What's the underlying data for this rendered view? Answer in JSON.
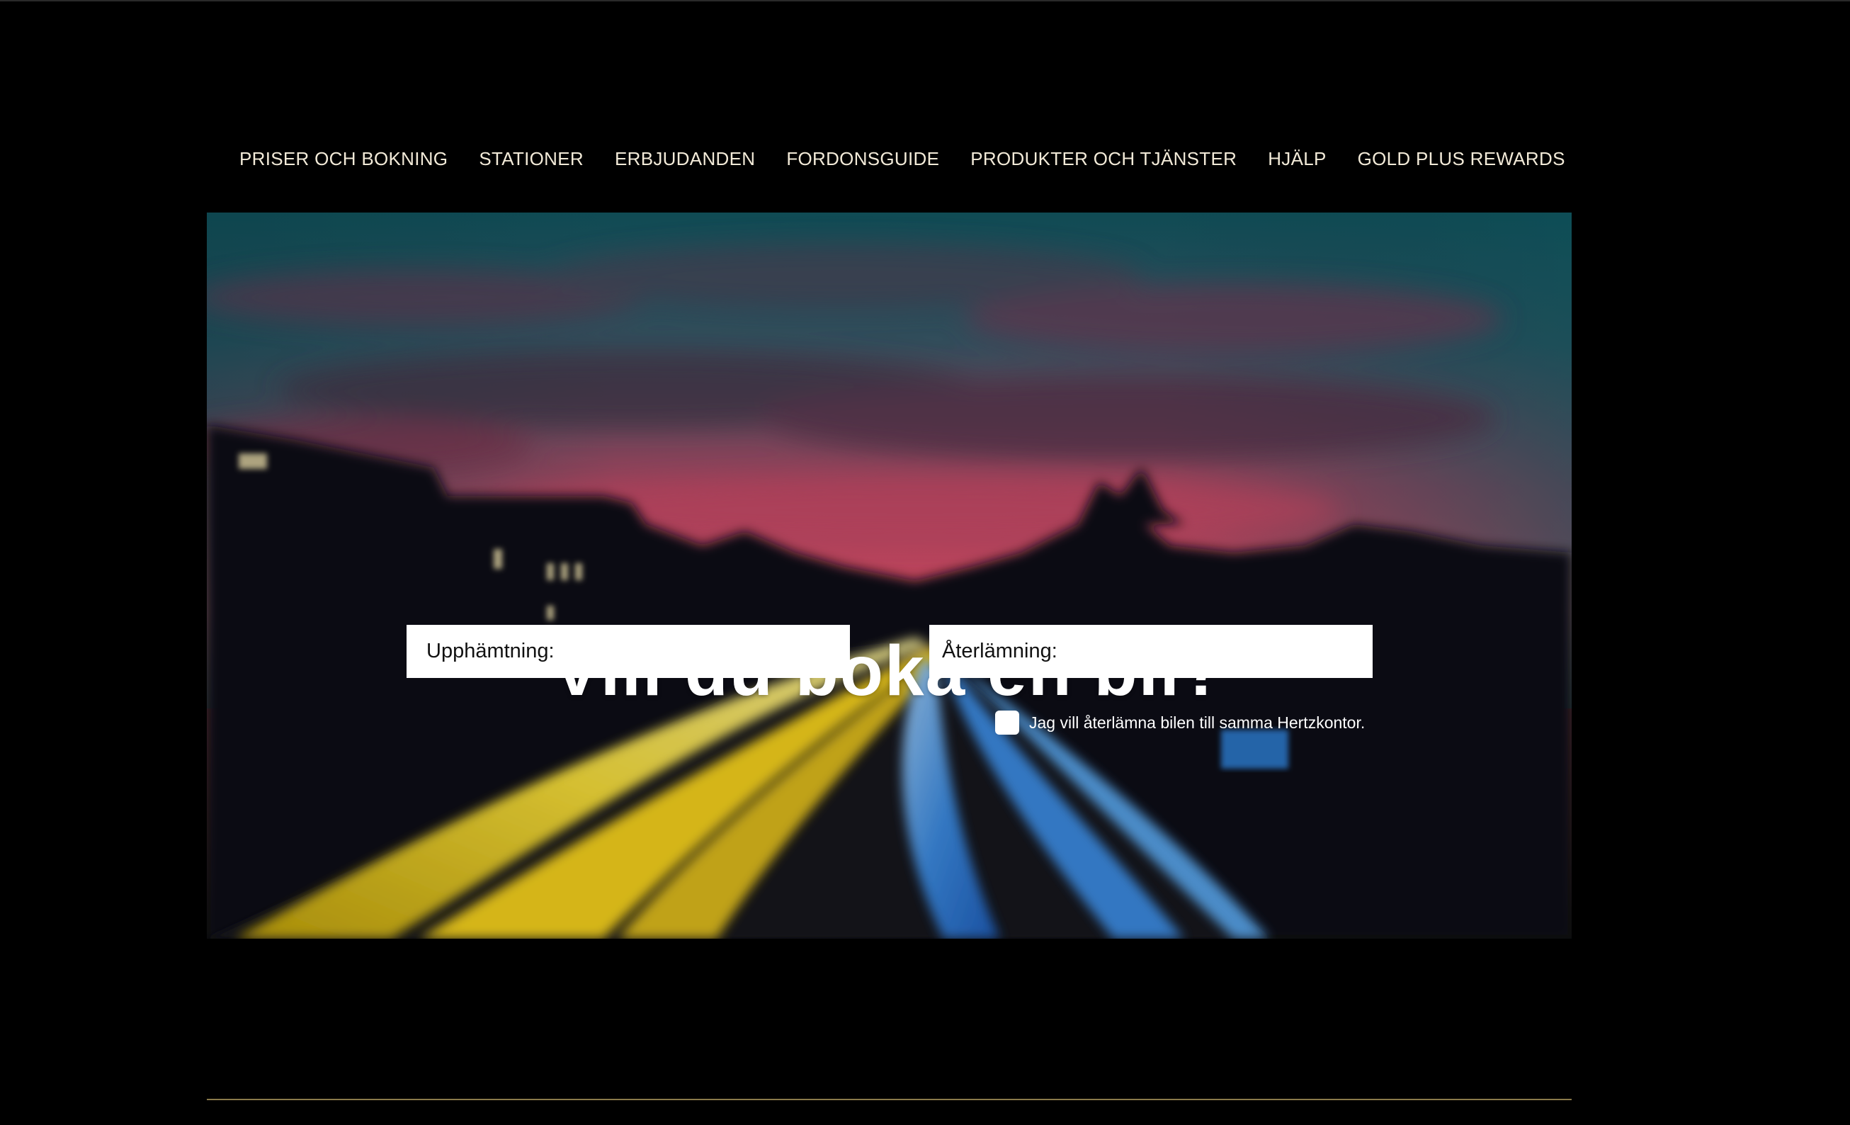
{
  "nav": {
    "items": [
      {
        "label": "PRISER OCH BOKNING"
      },
      {
        "label": "STATIONER"
      },
      {
        "label": "ERBJUDANDEN"
      },
      {
        "label": "FORDONSGUIDE"
      },
      {
        "label": "PRODUKTER OCH TJÄNSTER"
      },
      {
        "label": "HJÄLP"
      },
      {
        "label": "GOLD PLUS REWARDS"
      }
    ]
  },
  "hero": {
    "title": "Vill du boka en bil?",
    "pickup": {
      "label": "Upphämtning:",
      "value": "",
      "placeholder": ""
    },
    "dropoff": {
      "label": "Återlämning:",
      "value": "",
      "placeholder": ""
    },
    "same_office": {
      "label": "Jag vill återlämna bilen till samma Hertzkontor.",
      "checked": false
    }
  },
  "colors": {
    "background": "#000000",
    "nav_text": "#f2ead8",
    "divider": "#8a7a4a",
    "light_trail_yellow": "#f2d21a",
    "light_trail_blue": "#3d8fe8",
    "sky_pink": "#e8506a",
    "sky_teal": "#1a6a72"
  }
}
